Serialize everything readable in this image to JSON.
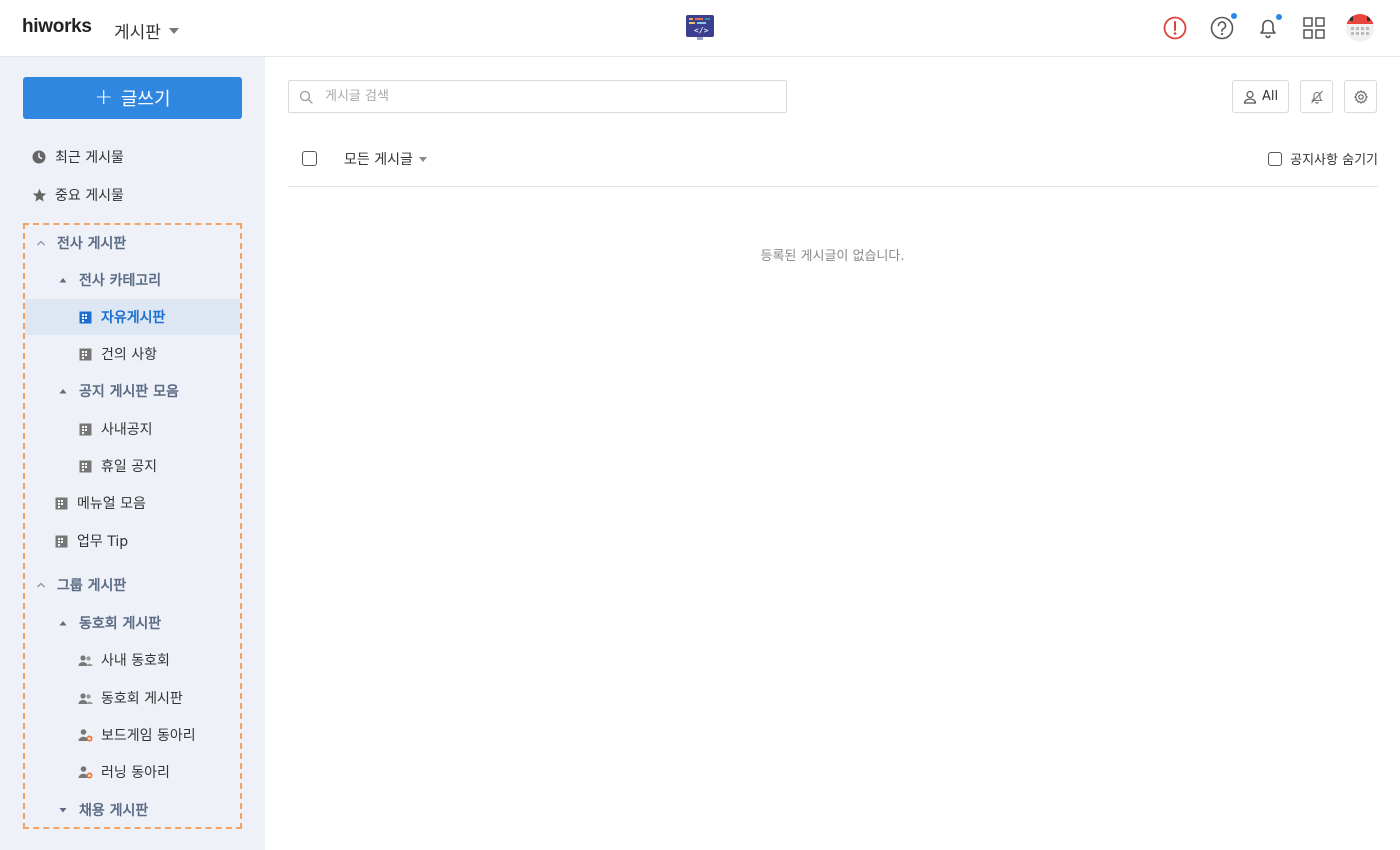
{
  "header": {
    "logo": "hiworks",
    "app_name": "게시판",
    "icons": [
      "alert-icon",
      "help-icon",
      "bell-icon",
      "apps-grid-icon",
      "avatar"
    ],
    "accent": "#2b87e3"
  },
  "sidebar": {
    "write_button": "글쓰기",
    "quick": [
      {
        "label": "최근 게시물",
        "icon": "clock-icon"
      },
      {
        "label": "중요 게시물",
        "icon": "star-icon"
      }
    ],
    "tree": [
      {
        "label": "전사 게시판",
        "type": "group",
        "icon": "chevron-up-icon"
      },
      {
        "label": "전사 카테고리",
        "type": "category",
        "icon": "triangle-up-icon"
      },
      {
        "label": "자유게시판",
        "type": "board",
        "icon": "board-icon",
        "active": true
      },
      {
        "label": "건의 사항",
        "type": "board",
        "icon": "board-icon"
      },
      {
        "label": "공지 게시판 모음",
        "type": "category",
        "icon": "triangle-up-icon"
      },
      {
        "label": "사내공지",
        "type": "board",
        "icon": "board-icon"
      },
      {
        "label": "휴일 공지",
        "type": "board",
        "icon": "board-icon"
      },
      {
        "label": "메뉴얼 모음",
        "type": "board-top",
        "icon": "board-icon"
      },
      {
        "label": "업무 Tip",
        "type": "board-top",
        "icon": "board-icon"
      },
      {
        "label": "그룹 게시판",
        "type": "group",
        "icon": "chevron-up-icon"
      },
      {
        "label": "동호회 게시판",
        "type": "category",
        "icon": "triangle-up-icon"
      },
      {
        "label": "사내 동호회",
        "type": "group-board",
        "icon": "users-icon"
      },
      {
        "label": "동호회 게시판",
        "type": "group-board",
        "icon": "users-icon"
      },
      {
        "label": "보드게임 동아리",
        "type": "group-board",
        "icon": "user-lock-icon"
      },
      {
        "label": "러닝 동아리",
        "type": "group-board",
        "icon": "user-lock-icon"
      },
      {
        "label": "채용 게시판",
        "type": "category",
        "icon": "triangle-down-icon"
      }
    ]
  },
  "main": {
    "search_placeholder": "게시글 검색",
    "all_button": "All",
    "filter_label": "모든 게시글",
    "hide_notice_label": "공지사항 숨기기",
    "empty_message": "등록된 게시글이 없습니다."
  }
}
